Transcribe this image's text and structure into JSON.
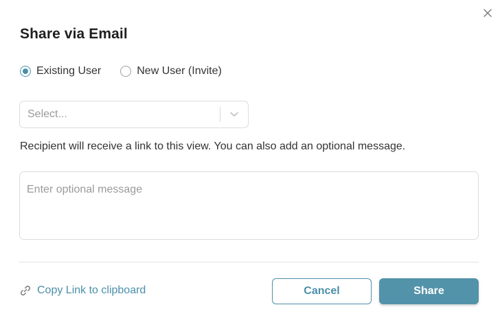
{
  "dialog": {
    "title": "Share via Email",
    "close_icon": "close-icon"
  },
  "recipient_type": {
    "options": [
      {
        "label": "Existing User",
        "checked": true
      },
      {
        "label": "New User (Invite)",
        "checked": false
      }
    ]
  },
  "user_select": {
    "placeholder": "Select...",
    "icon": "chevron-down-icon"
  },
  "info_text": "Recipient will receive a link to this view. You can also add an optional message.",
  "message": {
    "placeholder": "Enter optional message",
    "value": ""
  },
  "footer": {
    "copy_link_label": "Copy Link to clipboard",
    "copy_link_icon": "link-icon",
    "cancel_label": "Cancel",
    "share_label": "Share"
  },
  "colors": {
    "accent": "#4b8fa9",
    "share_button": "#5393a9",
    "border": "#dcdcdc",
    "placeholder": "#9a9a9a"
  }
}
